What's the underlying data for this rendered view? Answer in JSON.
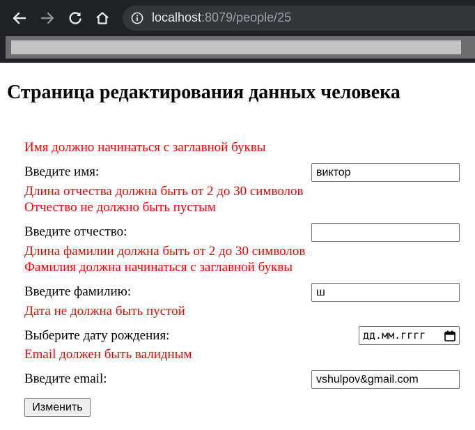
{
  "browser": {
    "url_host": "localhost",
    "url_path": ":8079/people/25",
    "icons": [
      "back-icon",
      "forward-icon",
      "reload-icon",
      "home-icon",
      "info-icon"
    ]
  },
  "page": {
    "title": "Страница редактирования данных человека"
  },
  "form": {
    "name_error": "Имя должно начинаться с заглавной буквы",
    "name_label": "Введите имя:",
    "name_value": "виктор",
    "patronymic_error_1": "Длина отчества должна быть от 2 до 30 символов",
    "patronymic_error_2": "Отчество не должно быть пустым",
    "patronymic_label": "Введите отчество:",
    "patronymic_value": "",
    "surname_error_1": "Длина фамилии должна быть от 2 до 30 символов",
    "surname_error_2": "Фамилия должна начинаться с заглавной буквы",
    "surname_label": "Введите фамилию:",
    "surname_value": "ш",
    "birthdate_error": "Дата не должна быть пустой",
    "birthdate_label": "Выберите дату рождения:",
    "birthdate_placeholder": "дд.мм.гггг",
    "email_error": "Email должен быть валидным",
    "email_label": "Введите email:",
    "email_value": "vshulpov&gmail.com",
    "submit_label": "Изменить"
  },
  "colors": {
    "error": "#ff0000",
    "chrome_bg": "#202124"
  }
}
